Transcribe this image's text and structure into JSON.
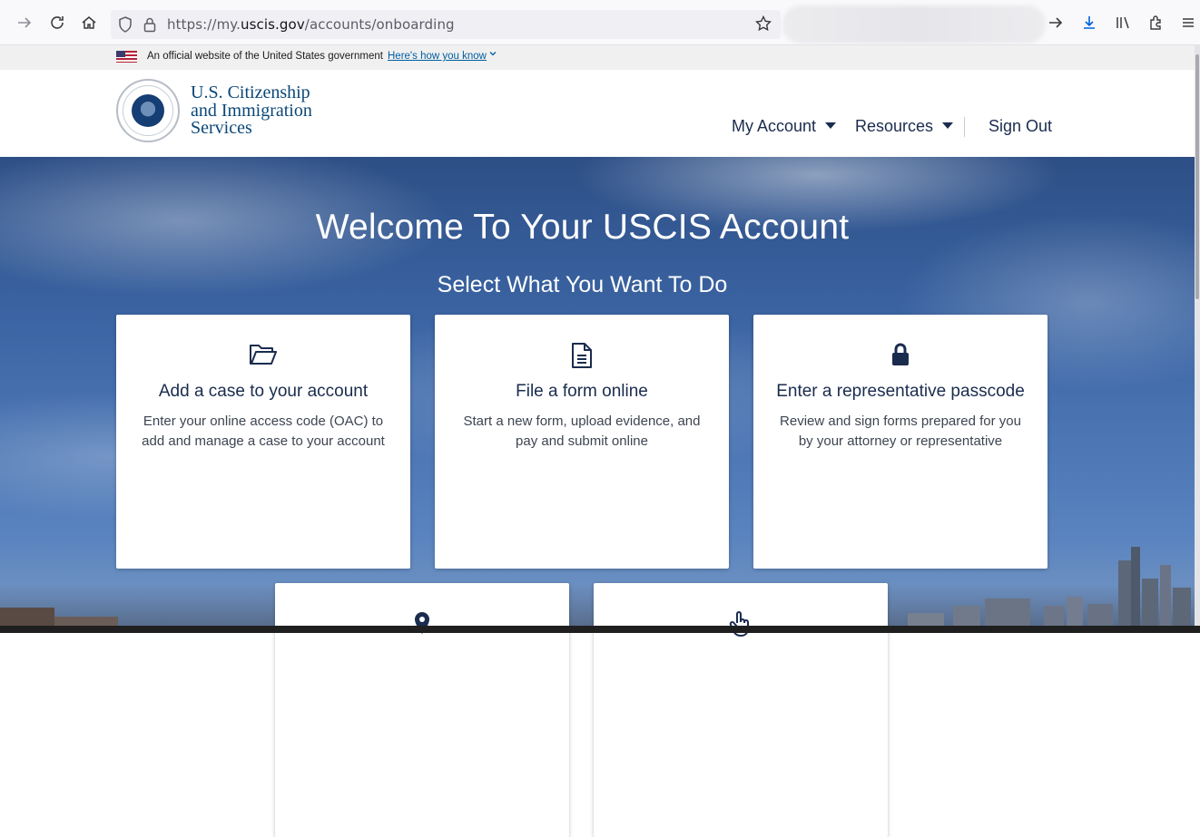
{
  "browser": {
    "url_prefix": "https://my.",
    "url_domain": "uscis.gov",
    "url_path": "/accounts/onboarding"
  },
  "gov_banner": {
    "text": "An official website of the United States government",
    "link": "Here's how you know"
  },
  "header": {
    "agency_line1": "U.S. Citizenship",
    "agency_line2": "and Immigration",
    "agency_line3": "Services",
    "nav": {
      "my_account": "My Account",
      "resources": "Resources",
      "sign_out": "Sign Out"
    }
  },
  "hero": {
    "title": "Welcome To Your USCIS Account",
    "subtitle": "Select What You Want To Do"
  },
  "cards": [
    {
      "icon": "folder-open-icon",
      "title": "Add a case to your account",
      "desc": "Enter your online access code (OAC) to add and manage a case to your account"
    },
    {
      "icon": "document-icon",
      "title": "File a form online",
      "desc": "Start a new form, upload evidence, and pay and submit online"
    },
    {
      "icon": "lock-icon",
      "title": "Enter a representative passcode",
      "desc": "Review and sign forms prepared for you by your attorney or representative"
    },
    {
      "icon": "location-pin-icon",
      "title": "",
      "desc": ""
    },
    {
      "icon": "pointer-hand-icon",
      "title": "",
      "desc": ""
    }
  ],
  "colors": {
    "brand_navy": "#1a2c4e",
    "agency_blue": "#0b4778",
    "gov_link": "#005ea2"
  }
}
